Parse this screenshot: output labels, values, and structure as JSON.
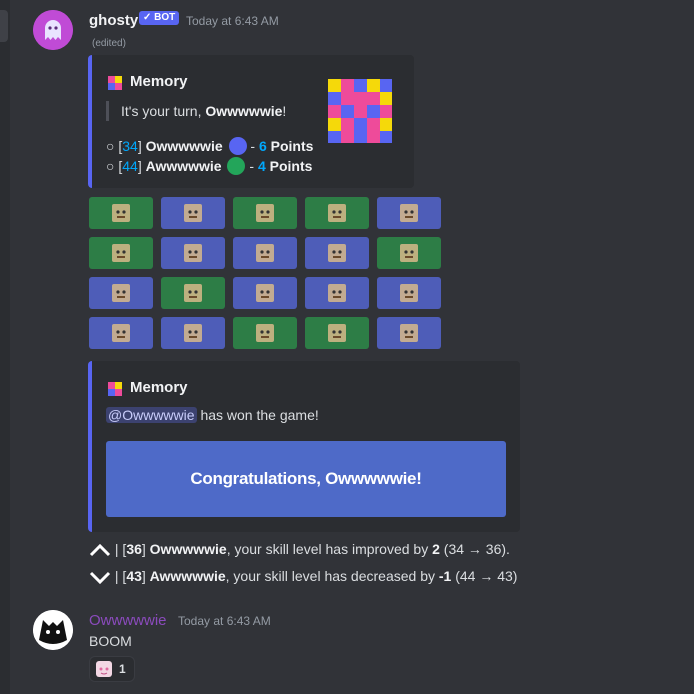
{
  "bot_message": {
    "username": "ghosty",
    "badge": "✓ BOT",
    "timestamp": "Today at 6:43 AM",
    "edited": "(edited)"
  },
  "embed_game": {
    "title": "Memory",
    "turn_prefix": "It's your turn, ",
    "turn_player": "Owwwwwie",
    "turn_suffix": "!",
    "players": [
      {
        "bullet": "○ ",
        "rank_open": "[",
        "rank": "34",
        "rank_close": "]",
        "name": "Owwwwwie",
        "color": "#5865f2",
        "points_prefix": " - ",
        "points": "6",
        "points_label": " Points"
      },
      {
        "bullet": "○ ",
        "rank_open": "[",
        "rank": "44",
        "rank_close": "]",
        "name": "Awwwwwie",
        "color": "#23a55a",
        "points_prefix": " - ",
        "points": "4",
        "points_label": " Points"
      }
    ]
  },
  "board": {
    "rows": [
      [
        {
          "color": "#2d7d46",
          "icon": "face-card"
        },
        {
          "color": "#4e5db8",
          "icon": "cat-card"
        },
        {
          "color": "#2d7d46",
          "icon": "pikachu-card"
        },
        {
          "color": "#2d7d46",
          "icon": "frog-card"
        },
        {
          "color": "#4e5db8",
          "icon": "meme-card"
        }
      ],
      [
        {
          "color": "#2d7d46",
          "icon": "pikachu-card"
        },
        {
          "color": "#4e5db8",
          "icon": "cat-card"
        },
        {
          "color": "#4e5db8",
          "icon": "squidward-card"
        },
        {
          "color": "#4e5db8",
          "icon": "doge-card"
        },
        {
          "color": "#2d7d46",
          "icon": "glass-card"
        }
      ],
      [
        {
          "color": "#4e5db8",
          "icon": "dog-card"
        },
        {
          "color": "#2d7d46",
          "icon": "frog-card"
        },
        {
          "color": "#4e5db8",
          "icon": "meme-card"
        },
        {
          "color": "#4e5db8",
          "icon": "monkey-card"
        },
        {
          "color": "#4e5db8",
          "icon": "dog-card"
        }
      ],
      [
        {
          "color": "#4e5db8",
          "icon": "monkey-card"
        },
        {
          "color": "#4e5db8",
          "icon": "doge-card"
        },
        {
          "color": "#2d7d46",
          "icon": "glass-card"
        },
        {
          "color": "#2d7d46",
          "icon": "face-card"
        },
        {
          "color": "#4e5db8",
          "icon": "squidward-card"
        }
      ]
    ]
  },
  "embed_result": {
    "title": "Memory",
    "mention": "@Owwwwwie",
    "won_text": " has won the game!",
    "banner": "Congratulations, Owwwwwie!"
  },
  "skill_updates": [
    {
      "direction": "up",
      "sep": " | ",
      "rank_open": "[",
      "rank": "36",
      "rank_close": "] ",
      "name": "Owwwwwie",
      "text": ", your skill level has improved by ",
      "delta": "2",
      "range": " (34 → 36)."
    },
    {
      "direction": "down",
      "sep": " | ",
      "rank_open": "[",
      "rank": "43",
      "rank_close": "] ",
      "name": "Awwwwwie",
      "text": ", your skill level has decreased by ",
      "delta": "-1",
      "range": " (44 → 43)"
    }
  ],
  "user_message": {
    "username": "Owwwwwie",
    "timestamp": "Today at 6:43 AM",
    "text": "BOOM",
    "reaction_count": "1"
  }
}
